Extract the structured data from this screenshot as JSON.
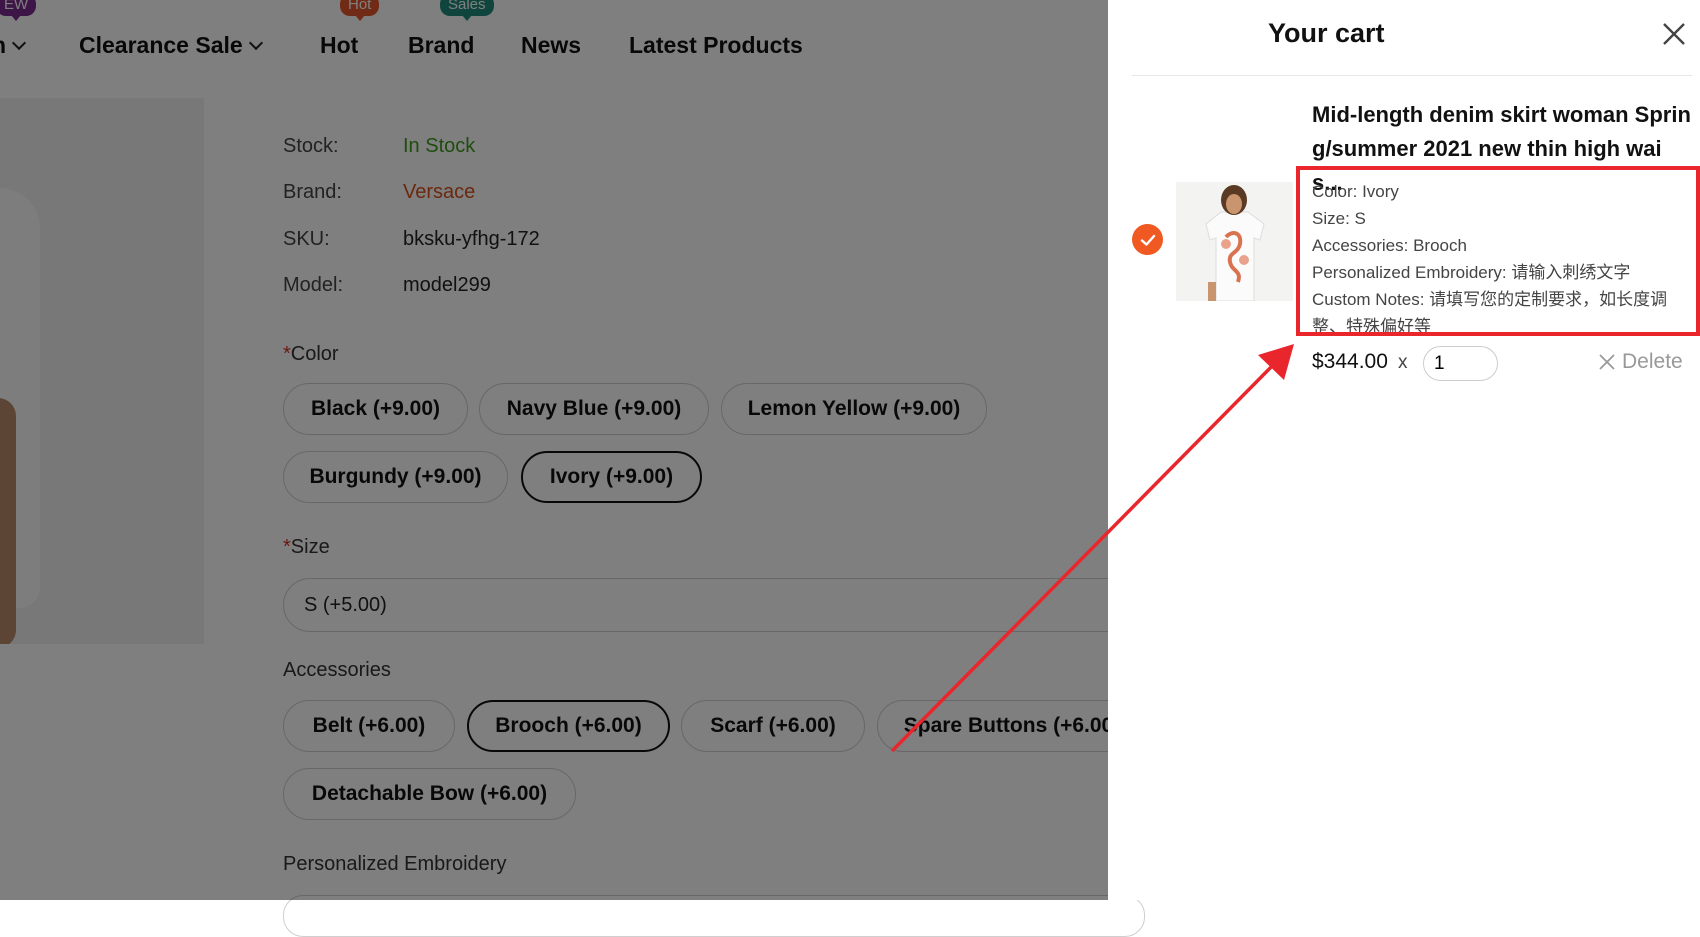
{
  "nav": {
    "items": [
      {
        "label": "n"
      },
      {
        "label": "Clearance Sale"
      },
      {
        "label": "Hot"
      },
      {
        "label": "Brand"
      },
      {
        "label": "News"
      },
      {
        "label": "Latest Products"
      }
    ],
    "badges": {
      "new": "EW",
      "hot": "Hot",
      "sales": "Sales"
    }
  },
  "product": {
    "info": [
      {
        "label": "Stock:",
        "value": "In Stock",
        "color": "#3e9b1d"
      },
      {
        "label": "Brand:",
        "value": "Versace",
        "color": "#d4521c"
      },
      {
        "label": "SKU:",
        "value": "bksku-yfhg-172",
        "color": "#222222"
      },
      {
        "label": "Model:",
        "value": "model299",
        "color": "#222222"
      }
    ],
    "color_label": "Color",
    "color_options": [
      "Black (+9.00)",
      "Navy Blue (+9.00)",
      "Lemon Yellow (+9.00)",
      "Burgundy (+9.00)",
      "Ivory (+9.00)"
    ],
    "color_selected": "Ivory (+9.00)",
    "size_label": "Size",
    "size_value": "S (+5.00)",
    "accessories_label": "Accessories",
    "accessory_options": [
      "Belt (+6.00)",
      "Brooch (+6.00)",
      "Scarf (+6.00)",
      "Spare Buttons (+6.00)",
      "Detachable Bow (+6.00)"
    ],
    "accessory_selected": "Brooch (+6.00)",
    "embroidery_label": "Personalized Embroidery",
    "required_mark": "*"
  },
  "cart": {
    "title": "Your cart",
    "item": {
      "title": "Mid-length denim skirt woman Spring/summer 2021 new thin high wais...",
      "attrs": [
        "Color: Ivory",
        "Size: S",
        "Accessories: Brooch",
        "Personalized Embroidery: 请输入刺绣文字",
        "Custom Notes: 请填写您的定制要求，如长度调整、特殊偏好等"
      ],
      "price": "$344.00",
      "times": "x",
      "quantity": "1",
      "delete_label": "Delete"
    }
  },
  "colors": {
    "accent": "#f05a22",
    "highlight": "#e8262c",
    "overlay": "rgba(0,0,0,0.5)"
  }
}
